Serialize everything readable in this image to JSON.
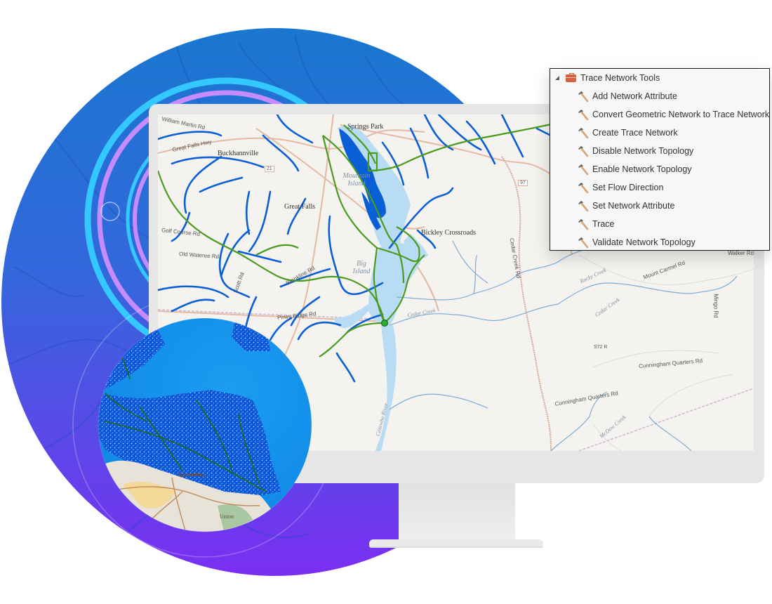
{
  "colors": {
    "hero_circle_top": "#1976d2",
    "hero_circle_bottom": "#7b2ff2",
    "ring_cyan": "#33c8ff",
    "ring_pink": "#c68cff",
    "stream_blue": "#0a5fd6",
    "trace_green": "#4a9b1e",
    "water_light": "#b9dcf5",
    "map_bg": "#f4f3ef",
    "panel_bg": "#f7f7f7",
    "toolbox_icon": "#d6603f"
  },
  "toolbox": {
    "title": "Trace Network Tools",
    "icon": "toolbox-icon",
    "expanded": true,
    "tools": [
      {
        "label": "Add Network Attribute",
        "icon": "hammer-icon"
      },
      {
        "label": "Convert Geometric Network to Trace Network",
        "icon": "hammer-icon"
      },
      {
        "label": "Create Trace Network",
        "icon": "hammer-icon"
      },
      {
        "label": "Disable Network Topology",
        "icon": "hammer-icon"
      },
      {
        "label": "Enable Network Topology",
        "icon": "hammer-icon"
      },
      {
        "label": "Set Flow Direction",
        "icon": "hammer-icon"
      },
      {
        "label": "Set Network Attribute",
        "icon": "hammer-icon"
      },
      {
        "label": "Trace",
        "icon": "hammer-icon"
      },
      {
        "label": "Validate Network Topology",
        "icon": "hammer-icon"
      }
    ]
  },
  "map": {
    "places": {
      "springs_park": "Springs Park",
      "buckhannville": "Buckhannville",
      "great_falls": "Great Falls",
      "mountain_island": "Mountain Island",
      "big_island": "Big Island",
      "bickley_crossroads": "Bickley Crossroads"
    },
    "roads": {
      "william_martin": "William Martin Rd",
      "great_falls_hwy": "Great Falls Hwy",
      "golf_course": "Golf Course Rd",
      "old_wateree": "Old Wateree Rd",
      "scott": "Scott Rd",
      "brookline": "Brookline Rd",
      "piney_ridge": "Piney Ridge Rd",
      "cedar_creek_rd": "Cedar Creek Rd",
      "mount_carmel": "Mount Carmel Rd",
      "cunningham_quarters": "Cunningham Quarters Rd",
      "cunningham_quarters_2": "Cunningham Quarters Rd",
      "mingo": "Mingo Rd",
      "walker": "Walker Rd",
      "s72": "S72 R",
      "route_21": "21",
      "route_97": "97"
    },
    "water": {
      "cedar_creek_1": "Cedar Creek",
      "cedar_creek_2": "Cedar Creek",
      "rocky_creek": "Rocky Creek",
      "mcdow_creek": "McDow Creek",
      "catawba_river": "Catawba River"
    }
  },
  "inset_map": {
    "places": {
      "spartanburg": "Spartanburg",
      "union": "Union"
    }
  }
}
